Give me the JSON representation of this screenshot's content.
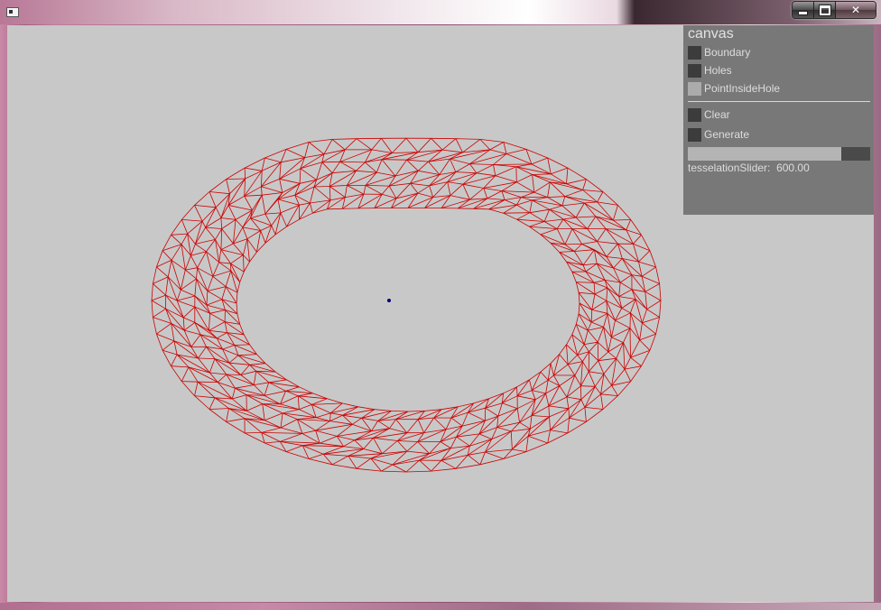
{
  "window": {
    "app_icon": "window-app-icon",
    "controls": {
      "minimize_icon": "minimize-icon",
      "maximize_icon": "maximize-icon",
      "close_glyph": "✕"
    }
  },
  "canvas": {
    "background": "#c8c8c8",
    "mesh_color": "#cc0000",
    "hole_point_color": "#00007a"
  },
  "panel": {
    "title": "canvas",
    "toggles": [
      {
        "label": "Boundary",
        "checked": false
      },
      {
        "label": "Holes",
        "checked": false
      },
      {
        "label": "PointInsideHole",
        "checked": true
      }
    ],
    "buttons": [
      {
        "label": "Clear"
      },
      {
        "label": "Generate"
      }
    ],
    "slider": {
      "name": "tesselationSlider:",
      "value_text": "600.00",
      "fraction": 0.84
    }
  }
}
